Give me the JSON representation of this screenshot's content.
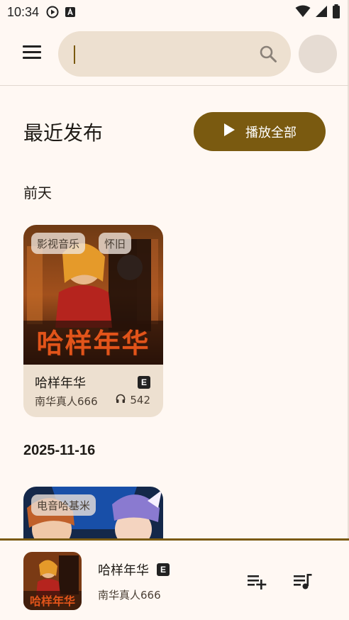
{
  "status_bar": {
    "time": "10:34"
  },
  "search": {
    "value": "",
    "placeholder": ""
  },
  "header": {
    "title": "最近发布",
    "play_all_label": "播放全部"
  },
  "groups": [
    {
      "date": "前天",
      "items": [
        {
          "title": "哈样年华",
          "artist": "南华真人666",
          "plays": "542",
          "explicit": "E",
          "tags": [
            "影视音乐",
            "怀旧"
          ],
          "cover_text": "哈样年华"
        }
      ]
    },
    {
      "date": "2025-11-16",
      "items": [
        {
          "tags": [
            "电音哈基米"
          ]
        }
      ]
    }
  ],
  "now_playing": {
    "title": "哈样年华",
    "artist": "南华真人666",
    "explicit": "E",
    "cover_text": "哈样年华"
  },
  "colors": {
    "accent": "#7a5a10",
    "surface": "#fff8f3",
    "card": "#ede0d0"
  }
}
